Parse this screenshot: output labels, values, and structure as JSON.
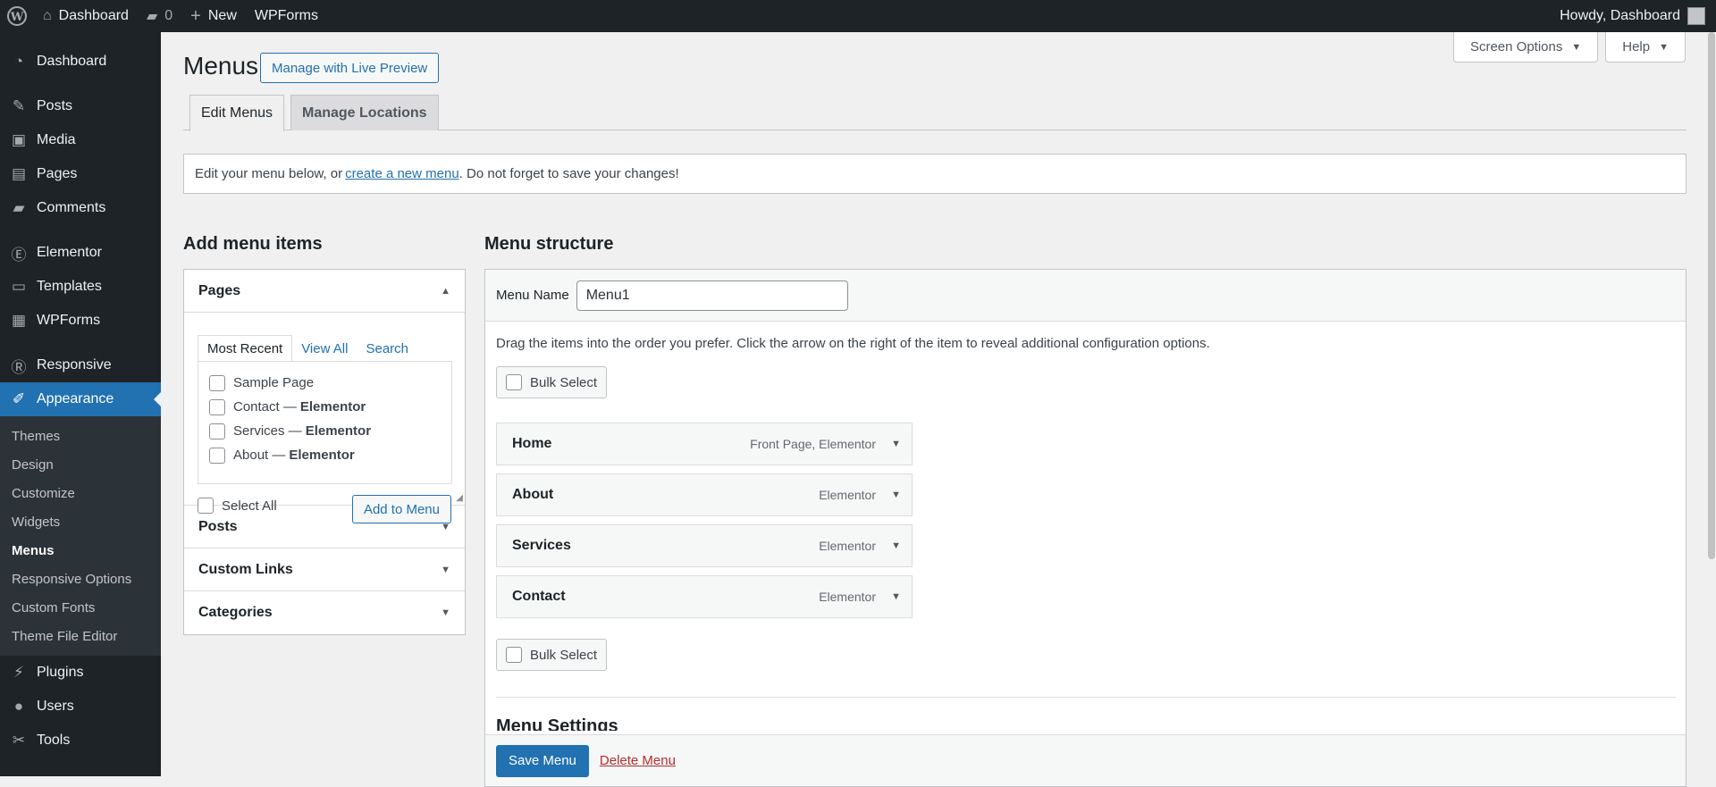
{
  "adminbar": {
    "wp_logo_icon": "wordpress-logo",
    "site_name": "Dashboard",
    "comments_count": "0",
    "new_label": "New",
    "wpforms_label": "WPForms",
    "howdy": "Howdy, Dashboard"
  },
  "sidebar": {
    "items": [
      {
        "label": "Dashboard",
        "icon": "dashboard-icon"
      },
      {
        "label": "Posts",
        "icon": "pin-icon"
      },
      {
        "label": "Media",
        "icon": "media-icon"
      },
      {
        "label": "Pages",
        "icon": "pages-icon"
      },
      {
        "label": "Comments",
        "icon": "comments-icon"
      },
      {
        "label": "Elementor",
        "icon": "elementor-icon"
      },
      {
        "label": "Templates",
        "icon": "folder-icon"
      },
      {
        "label": "WPForms",
        "icon": "forms-icon"
      },
      {
        "label": "Responsive",
        "icon": "responsive-icon"
      },
      {
        "label": "Appearance",
        "icon": "brush-icon"
      },
      {
        "label": "Plugins",
        "icon": "plugin-icon"
      },
      {
        "label": "Users",
        "icon": "users-icon"
      },
      {
        "label": "Tools",
        "icon": "tools-icon"
      }
    ],
    "appearance_sub": [
      "Themes",
      "Design",
      "Customize",
      "Widgets",
      "Menus",
      "Responsive Options",
      "Custom Fonts",
      "Theme File Editor"
    ]
  },
  "screen_options": "Screen Options",
  "help": "Help",
  "page_title": "Menus",
  "live_preview_label": "Manage with Live Preview",
  "tabs": {
    "edit": "Edit Menus",
    "locations": "Manage Locations"
  },
  "notice": {
    "before": "Edit your menu below, or",
    "link": "create a new menu",
    "after": ". Do not forget to save your changes!"
  },
  "add_items": {
    "title": "Add menu items",
    "pages_label": "Pages",
    "inner_tabs": [
      "Most Recent",
      "View All",
      "Search"
    ],
    "pages": [
      {
        "name": "Sample Page",
        "suffix": ""
      },
      {
        "name": "Contact — ",
        "suffix": "Elementor"
      },
      {
        "name": "Services — ",
        "suffix": "Elementor"
      },
      {
        "name": "About — ",
        "suffix": "Elementor"
      }
    ],
    "select_all": "Select All",
    "add_to_menu": "Add to Menu",
    "other_sections": [
      "Posts",
      "Custom Links",
      "Categories"
    ]
  },
  "structure": {
    "title": "Menu structure",
    "menu_name_label": "Menu Name",
    "menu_name_value": "Menu1",
    "drag_text": "Drag the items into the order you prefer. Click the arrow on the right of the item to reveal additional configuration options.",
    "bulk_select": "Bulk Select",
    "items": [
      {
        "title": "Home",
        "meta": "Front Page, Elementor"
      },
      {
        "title": "About",
        "meta": "Elementor"
      },
      {
        "title": "Services",
        "meta": "Elementor"
      },
      {
        "title": "Contact",
        "meta": "Elementor"
      }
    ],
    "settings_title": "Menu Settings",
    "save_label": "Save Menu",
    "delete_label": "Delete Menu"
  },
  "colors": {
    "accent": "#2271b1",
    "adminbar": "#1d2327",
    "delete": "#b32d2e"
  }
}
